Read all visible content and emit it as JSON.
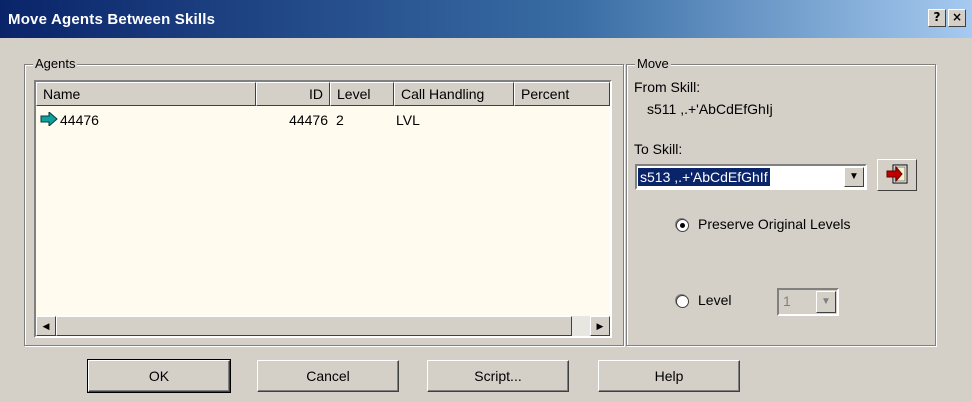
{
  "window": {
    "title": "Move Agents Between Skills",
    "help_btn": "?",
    "close_btn": "×"
  },
  "agents": {
    "group_label": "Agents",
    "columns": [
      "Name",
      "ID",
      "Level",
      "Call Handling",
      "Percent"
    ],
    "rows": [
      {
        "name": "44476",
        "id": "44476",
        "level": "2",
        "call_handling": "LVL",
        "percent": ""
      }
    ]
  },
  "move": {
    "group_label": "Move",
    "from_label": "From Skill:",
    "from_value": "s511 ,.+'AbCdEfGhIj",
    "to_label": "To Skill:",
    "to_value": "s513 ,.+'AbCdEfGhIf",
    "preserve_label": "Preserve Original Levels",
    "preserve_selected": true,
    "level_label": "Level",
    "level_value": "1"
  },
  "buttons": {
    "ok": "OK",
    "cancel": "Cancel",
    "script": "Script...",
    "help": "Help"
  },
  "colors": {
    "accent": "#0a246a",
    "list_bg": "#fffbee",
    "face": "#d4d0c8"
  }
}
